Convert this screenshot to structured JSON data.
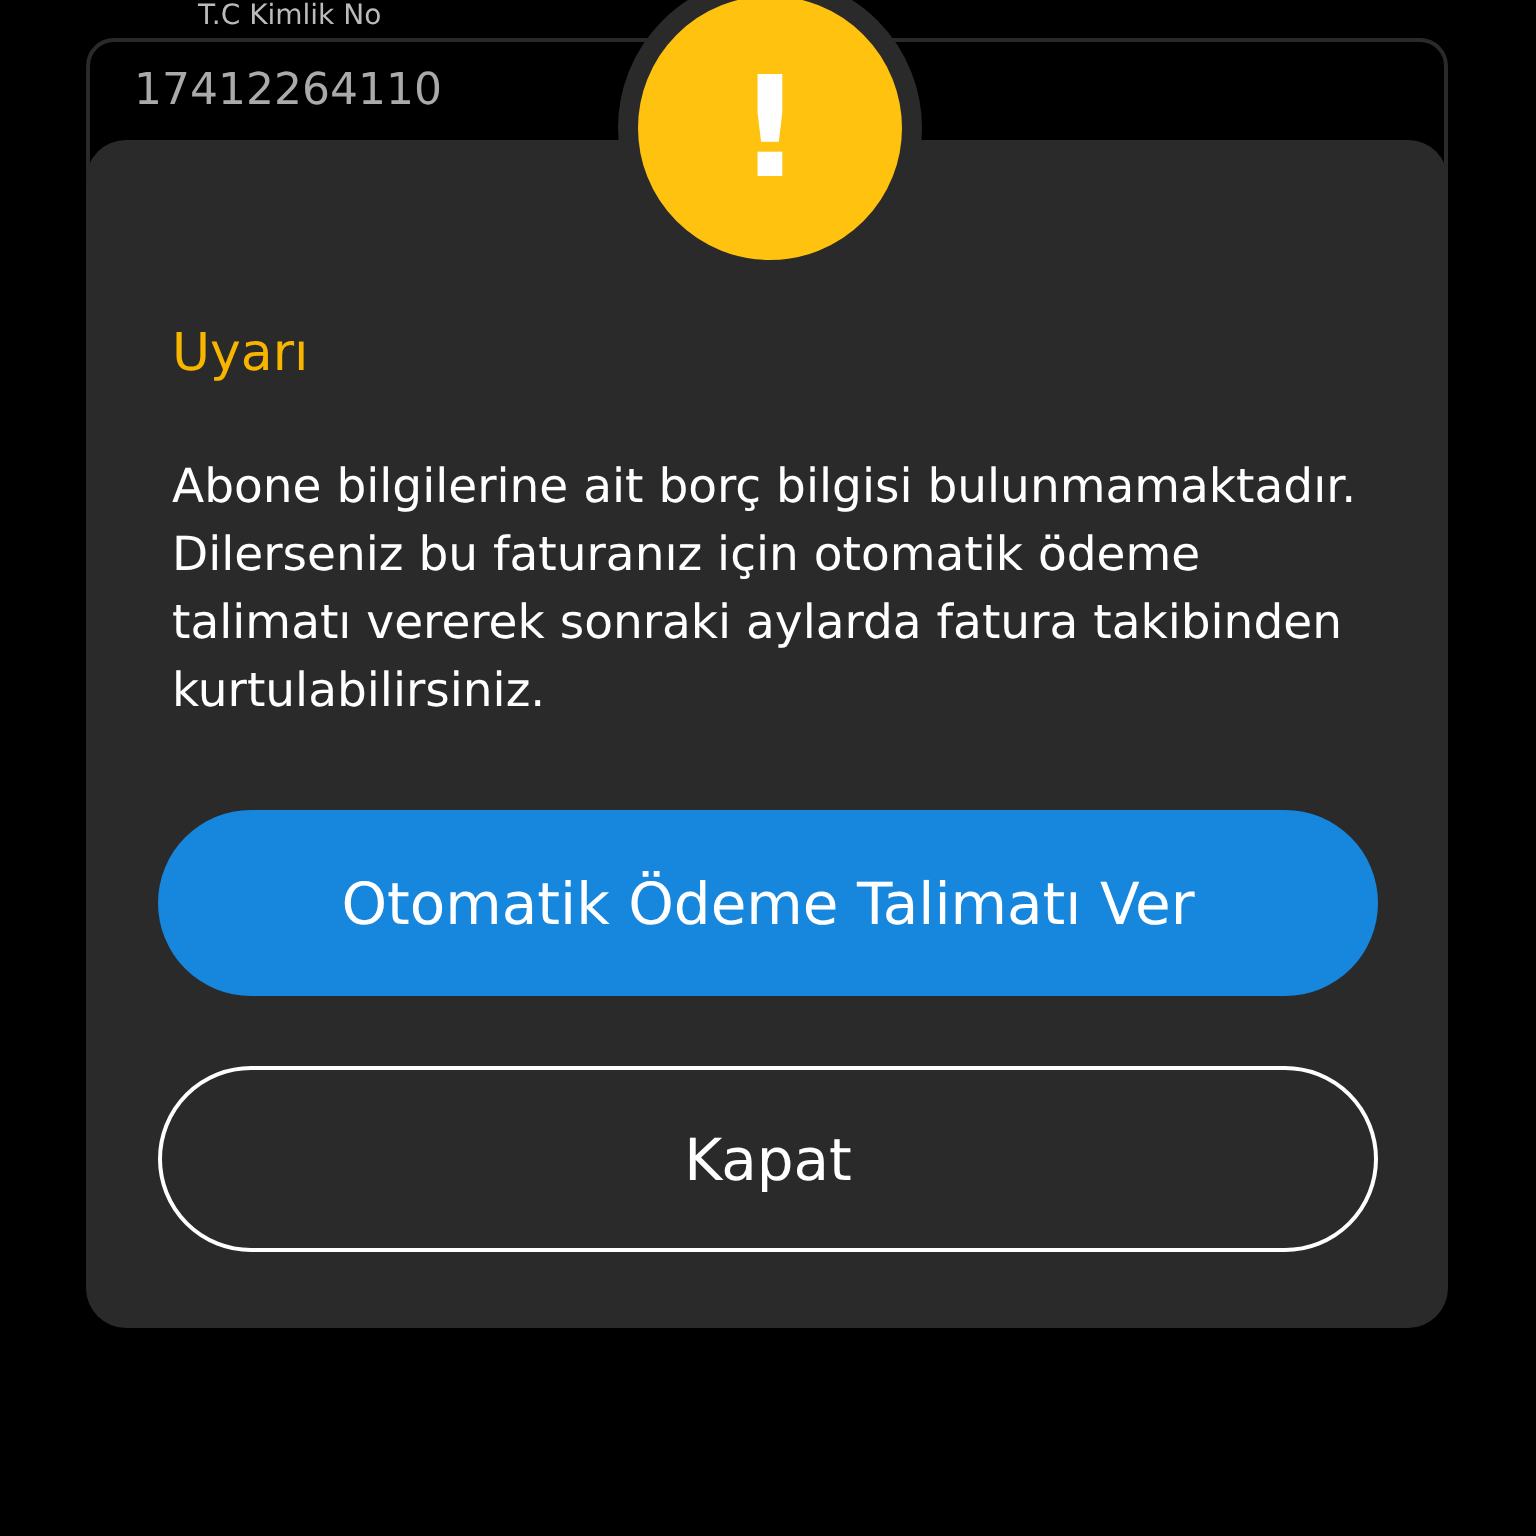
{
  "background_form": {
    "label": "T.C Kimlik No",
    "value": "17412264110"
  },
  "dialog": {
    "icon": "!",
    "title": "Uyarı",
    "message": "Abone bilgilerine ait borç bilgisi bulunmamaktadır. Dilerseniz bu faturanız için otomatik ödeme talimatı vererek sonraki aylarda fatura takibinden kurtulabilirsiniz.",
    "buttons": [
      {
        "label": "Otomatik Ödeme Talimatı Ver",
        "kind": "primary"
      },
      {
        "label": "Kapat",
        "kind": "outline"
      }
    ]
  }
}
